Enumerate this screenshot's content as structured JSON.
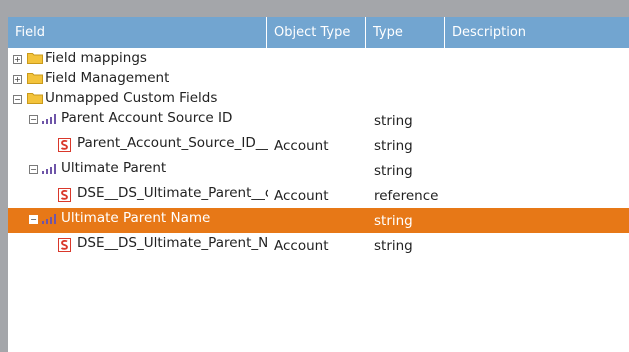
{
  "columns": [
    "Field",
    "Object Type",
    "Type",
    "Description"
  ],
  "rows": [
    {
      "label": "Field mappings",
      "object_type": "",
      "type": "",
      "description": ""
    },
    {
      "label": "Field Management",
      "object_type": "",
      "type": "",
      "description": ""
    },
    {
      "label": "Unmapped Custom Fields",
      "object_type": "",
      "type": "",
      "description": ""
    },
    {
      "label": "Parent Account Source ID",
      "object_type": "",
      "type": "string",
      "description": ""
    },
    {
      "label": "Parent_Account_Source_ID__c",
      "object_type": "Account",
      "type": "string",
      "description": ""
    },
    {
      "label": "Ultimate Parent",
      "object_type": "",
      "type": "string",
      "description": ""
    },
    {
      "label": "DSE__DS_Ultimate_Parent__c",
      "object_type": "Account",
      "type": "reference",
      "description": ""
    },
    {
      "label": "Ultimate Parent Name",
      "object_type": "",
      "type": "string",
      "description": ""
    },
    {
      "label": "DSE__DS_Ultimate_Parent_Name__c",
      "object_type": "Account",
      "type": "string",
      "description": ""
    }
  ],
  "toggles": {
    "expand": "+",
    "collapse": "−"
  },
  "icons": {
    "group": "folder-icon",
    "mapped_field": "signal-icon",
    "source_field": "salesforce-field-icon"
  },
  "colors": {
    "header": "#72a5d0",
    "selected_row": "#e77817",
    "folder": "#f3c33b",
    "signal": "#6e55a8",
    "field_icon": "#d9382b"
  }
}
